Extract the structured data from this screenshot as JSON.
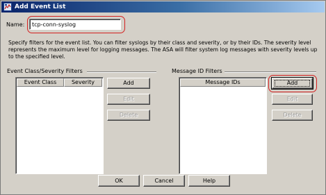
{
  "window": {
    "title": "Add Event List",
    "icon": "asdm-app-icon"
  },
  "name_field": {
    "label": "Name:",
    "value": "tcp-conn-syslog"
  },
  "description": "Specify filters for the event list. You can filter syslogs by their class and severity, or by their IDs. The severity level represents the maximum level for logging messages. The ASA will filter system log messages with severity levels up to the specified level.",
  "event_class_filters": {
    "title": "Event Class/Severity Filters",
    "columns": [
      "Event Class",
      "Severity"
    ],
    "rows": [],
    "buttons": {
      "add": "Add",
      "edit": "Edit",
      "delete": "Delete"
    }
  },
  "message_id_filters": {
    "title": "Message ID Filters",
    "columns": [
      "Message IDs"
    ],
    "rows": [],
    "buttons": {
      "add": "Add",
      "edit": "Edit",
      "delete": "Delete"
    }
  },
  "footer": {
    "ok": "OK",
    "cancel": "Cancel",
    "help": "Help"
  },
  "colors": {
    "highlight": "#d42020",
    "title_bar": "#0a246a",
    "dialog_bg": "#d4d0c8"
  }
}
